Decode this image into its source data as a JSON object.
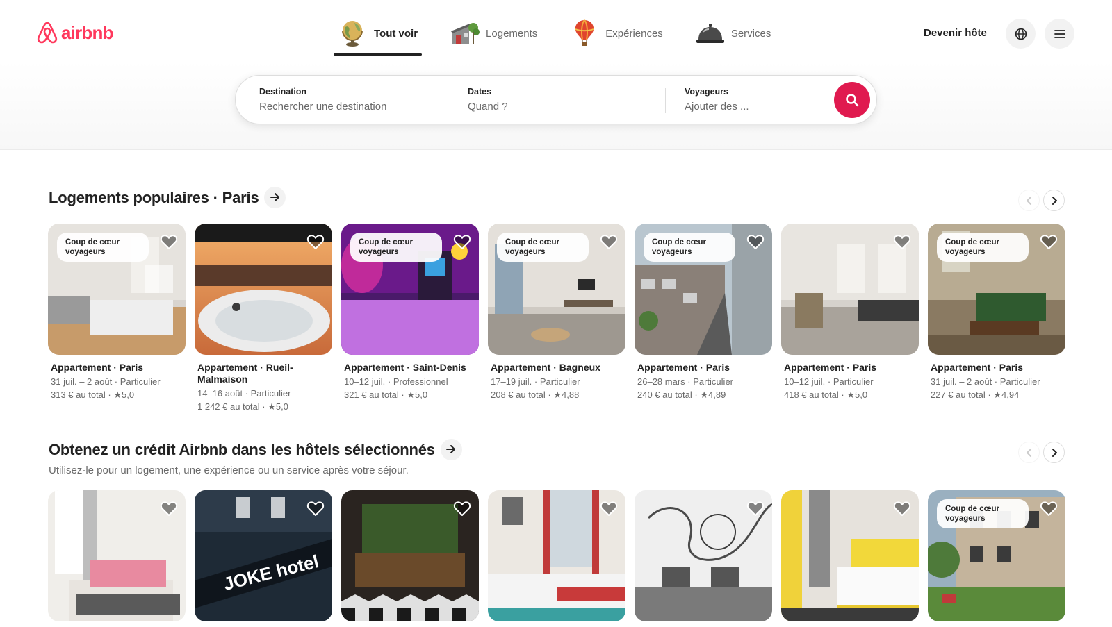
{
  "brand": {
    "name": "airbnb",
    "color": "#ff385c"
  },
  "nav": {
    "tabs": [
      {
        "label": "Tout voir",
        "icon": "globe-icon",
        "active": true
      },
      {
        "label": "Logements",
        "icon": "house-icon",
        "active": false
      },
      {
        "label": "Expériences",
        "icon": "hot-air-balloon-icon",
        "active": false
      },
      {
        "label": "Services",
        "icon": "service-bell-icon",
        "active": false
      }
    ],
    "host_label": "Devenir hôte",
    "language_icon": "globe-outline-icon",
    "menu_icon": "hamburger-menu-icon"
  },
  "search": {
    "destination": {
      "label": "Destination",
      "placeholder": "Rechercher une destination"
    },
    "dates": {
      "label": "Dates",
      "placeholder": "Quand ?"
    },
    "guests": {
      "label": "Voyageurs",
      "placeholder": "Ajouter des ..."
    },
    "button_icon": "search-icon",
    "button_color": "#e01a4f"
  },
  "sections": [
    {
      "title": "Logements populaires · Paris",
      "subtitle": "",
      "cards": [
        {
          "badge": "Coup de cœur voyageurs",
          "title": "Appartement · Paris",
          "dates": "31 juil. – 2 août · Particulier",
          "price": "313 € au total · ★5,0"
        },
        {
          "badge": "",
          "title": "Appartement · Rueil-Malmaison",
          "dates": "14–16 août · Particulier",
          "price": "1 242 € au total · ★5,0"
        },
        {
          "badge": "Coup de cœur voyageurs",
          "title": "Appartement · Saint-Denis",
          "dates": "10–12 juil. · Professionnel",
          "price": "321 € au total · ★5,0"
        },
        {
          "badge": "Coup de cœur voyageurs",
          "title": "Appartement · Bagneux",
          "dates": "17–19 juil. · Particulier",
          "price": "208 € au total · ★4,88"
        },
        {
          "badge": "Coup de cœur voyageurs",
          "title": "Appartement · Paris",
          "dates": "26–28 mars · Particulier",
          "price": "240 € au total · ★4,89"
        },
        {
          "badge": "",
          "title": "Appartement · Paris",
          "dates": "10–12 juil. · Particulier",
          "price": "418 € au total · ★5,0"
        },
        {
          "badge": "Coup de cœur voyageurs",
          "title": "Appartement · Paris",
          "dates": "31 juil. – 2 août · Particulier",
          "price": "227 € au total · ★4,94"
        }
      ]
    },
    {
      "title": "Obtenez un crédit Airbnb dans les hôtels sélectionnés",
      "subtitle": "Utilisez-le pour un logement, une expérience ou un service après votre séjour.",
      "cards": [
        {
          "badge": ""
        },
        {
          "badge": "",
          "sign_text": "JOKE hotel"
        },
        {
          "badge": ""
        },
        {
          "badge": ""
        },
        {
          "badge": ""
        },
        {
          "badge": ""
        },
        {
          "badge": "Coup de cœur voyageurs"
        }
      ]
    }
  ],
  "icons": {
    "heart": "heart-icon",
    "arrow_right": "arrow-right-icon",
    "chevron_left": "chevron-left-icon",
    "chevron_right": "chevron-right-icon"
  }
}
